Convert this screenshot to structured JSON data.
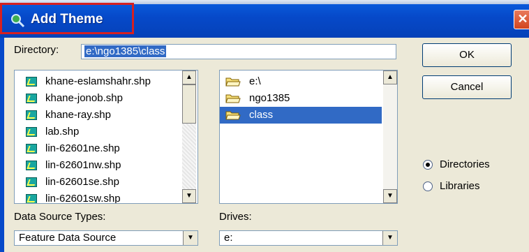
{
  "window": {
    "title": "Add Theme",
    "close_glyph": "✕",
    "app_icon": "magnifier-icon"
  },
  "directory": {
    "label": "Directory:",
    "value": "e:\\ngo1385\\class"
  },
  "buttons": {
    "ok": "OK",
    "cancel": "Cancel"
  },
  "files": [
    "khane-eslamshahr.shp",
    "khane-jonob.shp",
    "khane-ray.shp",
    "lab.shp",
    "lin-62601ne.shp",
    "lin-62601nw.shp",
    "lin-62601se.shp",
    "lin-62601sw.shp"
  ],
  "folders": [
    {
      "name": "e:\\",
      "selected": false
    },
    {
      "name": "ngo1385",
      "selected": false
    },
    {
      "name": "class",
      "selected": true
    }
  ],
  "data_source_types": {
    "label": "Data Source Types:",
    "value": "Feature Data Source"
  },
  "drives": {
    "label": "Drives:",
    "value": "e:"
  },
  "radio_options": [
    {
      "label": "Directories",
      "checked": true
    },
    {
      "label": "Libraries",
      "checked": false
    }
  ],
  "icons": {
    "up": "▲",
    "down": "▼"
  },
  "colors": {
    "title_bar": "#0649c9",
    "highlight": "#d62020",
    "selection": "#316ac5"
  }
}
